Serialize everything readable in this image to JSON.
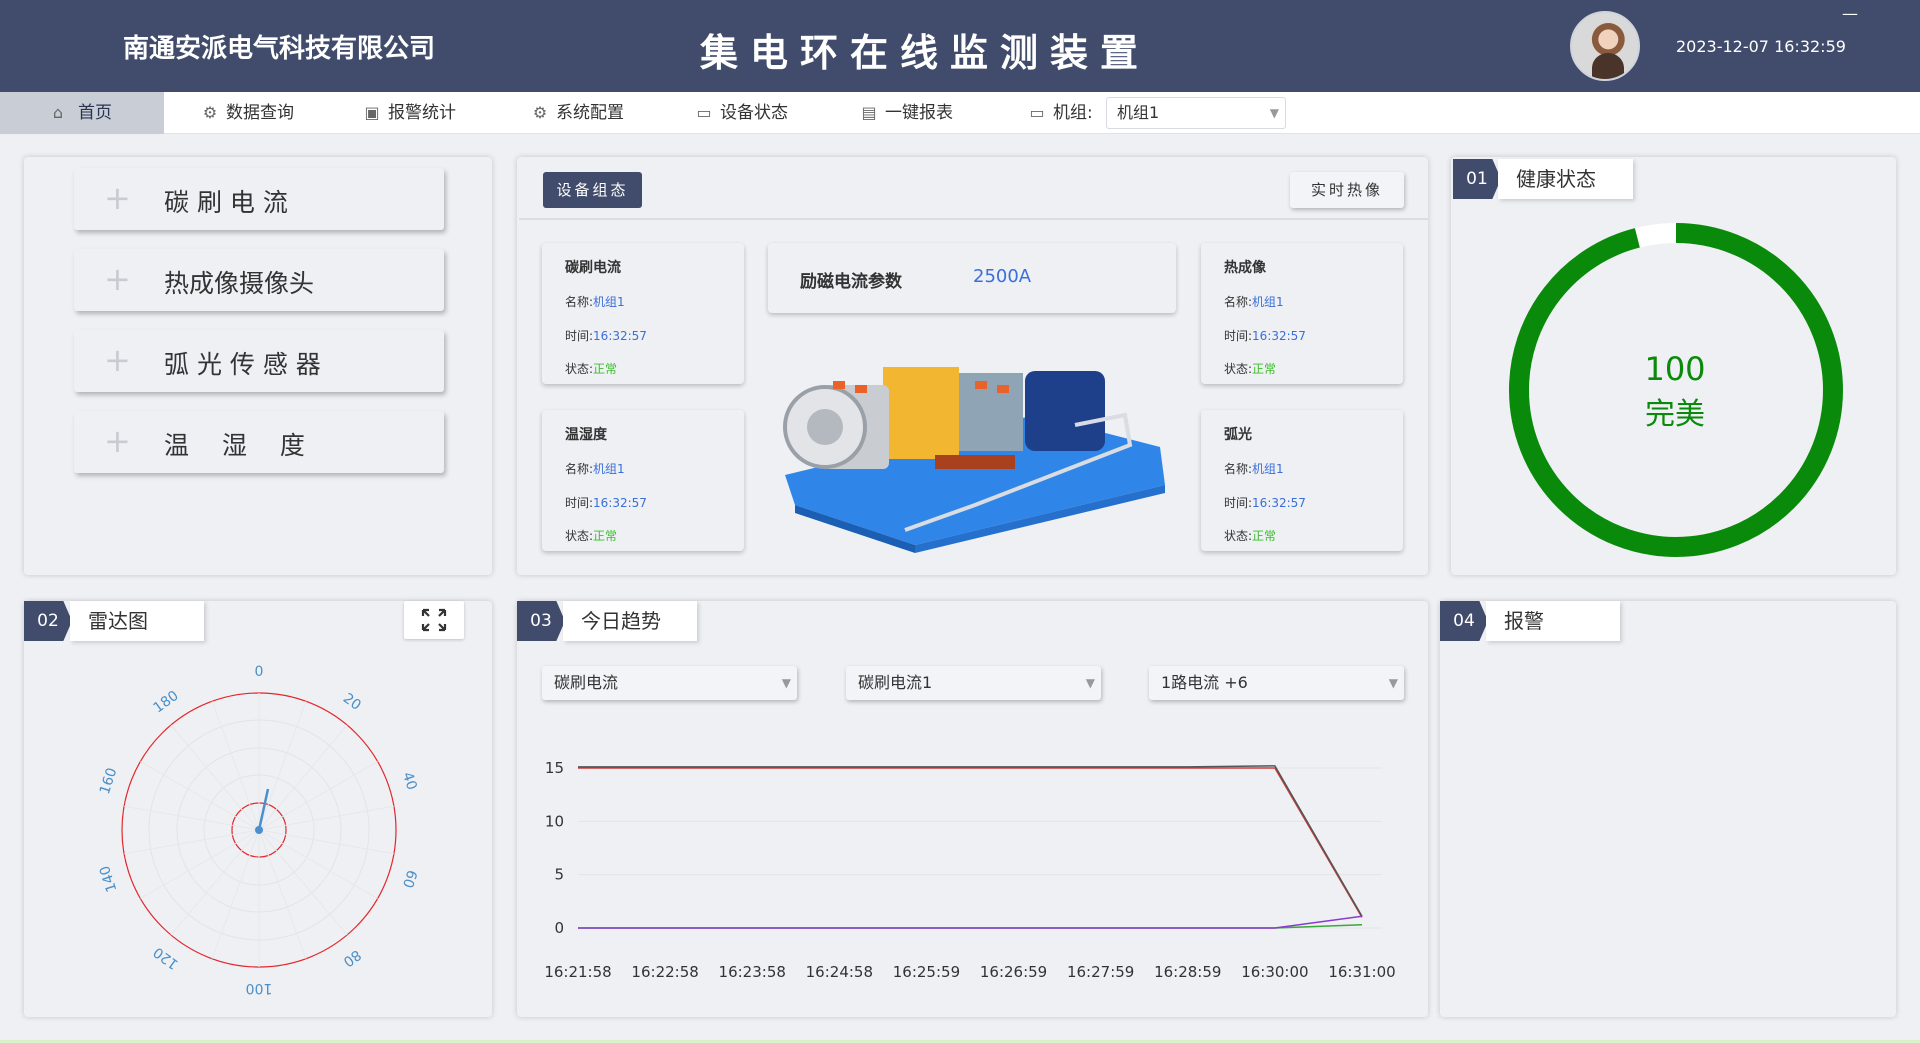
{
  "header": {
    "company": "南通安派电气科技有限公司",
    "title": "集电环在线监测装置",
    "datetime": "2023-12-07 16:32:59",
    "minimize": "—"
  },
  "nav": {
    "items": [
      {
        "label": "首页",
        "icon": "home-icon"
      },
      {
        "label": "数据查询",
        "icon": "settings-icon"
      },
      {
        "label": "报警统计",
        "icon": "image-icon"
      },
      {
        "label": "系统配置",
        "icon": "gear-icon"
      },
      {
        "label": "设备状态",
        "icon": "monitor-icon"
      },
      {
        "label": "一键报表",
        "icon": "document-icon"
      }
    ],
    "unit_label": "机组:",
    "unit_value": "机组1"
  },
  "sensors": [
    "碳 刷 电 流",
    "热成像摄像头",
    "弧 光 传 感 器",
    "温　 湿　 度"
  ],
  "device": {
    "tab": "设备组态",
    "thermal_button": "实时热像",
    "param_label": "励磁电流参数",
    "param_value": "2500A",
    "cards": [
      {
        "title": "碳刷电流",
        "name_label": "名称:",
        "name": "机组1",
        "time_label": "时间:",
        "time": "16:32:57",
        "status_label": "状态:",
        "status": "正常"
      },
      {
        "title": "热成像",
        "name_label": "名称:",
        "name": "机组1",
        "time_label": "时间:",
        "time": "16:32:57",
        "status_label": "状态:",
        "status": "正常"
      },
      {
        "title": "温湿度",
        "name_label": "名称:",
        "name": "机组1",
        "time_label": "时间:",
        "time": "16:32:57",
        "status_label": "状态:",
        "status": "正常"
      },
      {
        "title": "弧光",
        "name_label": "名称:",
        "name": "机组1",
        "time_label": "时间:",
        "time": "16:32:57",
        "status_label": "状态:",
        "status": "正常"
      }
    ]
  },
  "health": {
    "num": "01",
    "label": "健康状态",
    "value": "100",
    "text": "完美",
    "level": 0.96,
    "color": "#0a8a0a"
  },
  "radar": {
    "num": "02",
    "label": "雷达图",
    "angles": [
      "0",
      "20",
      "40",
      "60",
      "80",
      "100",
      "120",
      "140",
      "160",
      "180"
    ]
  },
  "trend": {
    "num": "03",
    "label": "今日趋势",
    "selects": [
      "碳刷电流",
      "碳刷电流1",
      "1路电流 +6"
    ],
    "chart_data": {
      "type": "line",
      "x": [
        "16:21:58",
        "16:22:58",
        "16:23:58",
        "16:24:58",
        "16:25:59",
        "16:26:59",
        "16:27:59",
        "16:28:59",
        "16:30:00",
        "16:31:00"
      ],
      "yticks": [
        0,
        5,
        10,
        15
      ],
      "ylim": [
        0,
        15
      ],
      "series": [
        {
          "color": "#d23a3a",
          "values": [
            15,
            15,
            15,
            15,
            15,
            15,
            15,
            15,
            15,
            1
          ]
        },
        {
          "color": "#555555",
          "values": [
            15.1,
            15.1,
            15.1,
            15.1,
            15.1,
            15.1,
            15.1,
            15.1,
            15.2,
            1.1
          ]
        },
        {
          "color": "#3aa83a",
          "values": [
            0,
            0,
            0,
            0,
            0,
            0,
            0,
            0,
            0,
            0.3
          ]
        },
        {
          "color": "#8a3ad2",
          "values": [
            0,
            0,
            0,
            0,
            0,
            0,
            0,
            0,
            0,
            1.1
          ]
        }
      ],
      "grid": true
    }
  },
  "alarm": {
    "num": "04",
    "label": "报警"
  }
}
